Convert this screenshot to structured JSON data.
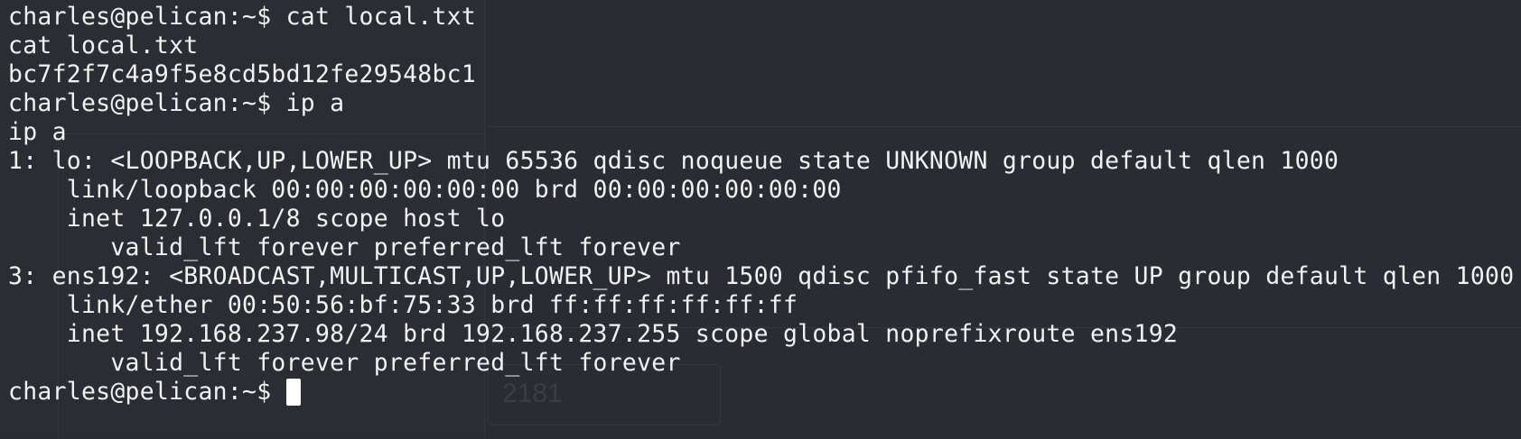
{
  "terminal": {
    "lines": [
      "charles@pelican:~$ cat local.txt",
      "cat local.txt",
      "bc7f2f7c4a9f5e8cd5bd12fe29548bc1",
      "charles@pelican:~$ ip a",
      "ip a",
      "1: lo: <LOOPBACK,UP,LOWER_UP> mtu 65536 qdisc noqueue state UNKNOWN group default qlen 1000",
      "    link/loopback 00:00:00:00:00:00 brd 00:00:00:00:00:00",
      "    inet 127.0.0.1/8 scope host lo",
      "       valid_lft forever preferred_lft forever",
      "3: ens192: <BROADCAST,MULTICAST,UP,LOWER_UP> mtu 1500 qdisc pfifo_fast state UP group default qlen 1000",
      "    link/ether 00:50:56:bf:75:33 brd ff:ff:ff:ff:ff:ff",
      "    inet 192.168.237.98/24 brd 192.168.237.255 scope global noprefixroute ens192",
      "       valid_lft forever preferred_lft forever"
    ],
    "prompt": "charles@pelican:~$ "
  },
  "background": {
    "ghost_value": "2181"
  },
  "colors": {
    "background": "#2a2c34",
    "text": "#f2f2f2",
    "cursor": "#ffffff"
  }
}
